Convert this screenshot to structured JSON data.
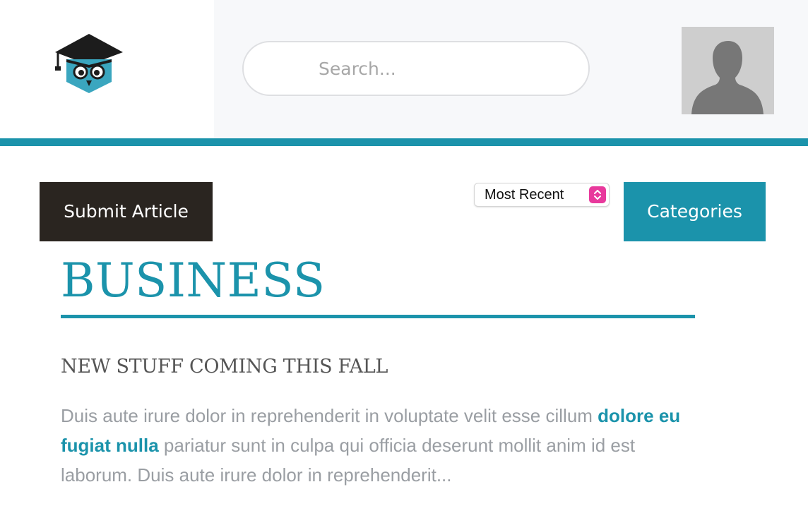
{
  "header": {
    "logo_alt": "Owl with graduation cap",
    "search": {
      "placeholder": "Search...",
      "value": ""
    }
  },
  "toolbar": {
    "submit_label": "Submit Article",
    "sort": {
      "selected": "Most Recent"
    },
    "categories_label": "Categories"
  },
  "section": {
    "title": "BUSINESS"
  },
  "article": {
    "title": "NEW STUFF COMING THIS FALL",
    "excerpt_before": "Duis aute irure dolor in reprehenderit in voluptate velit esse cillum ",
    "excerpt_link": "dolore eu fugiat nulla",
    "excerpt_after": " pariatur sunt in culpa qui officia deserunt mollit anim id est laborum. Duis aute irure dolor in reprehenderit..."
  },
  "colors": {
    "accent": "#1b93ab",
    "dark_button": "#2a2520",
    "select_arrows": "#e8399c",
    "muted_text": "#9a9ea3"
  },
  "icons": {
    "logo": "owl-graduation-cap-icon",
    "avatar": "user-silhouette-icon",
    "select_arrows": "up-down-chevron-icon"
  }
}
